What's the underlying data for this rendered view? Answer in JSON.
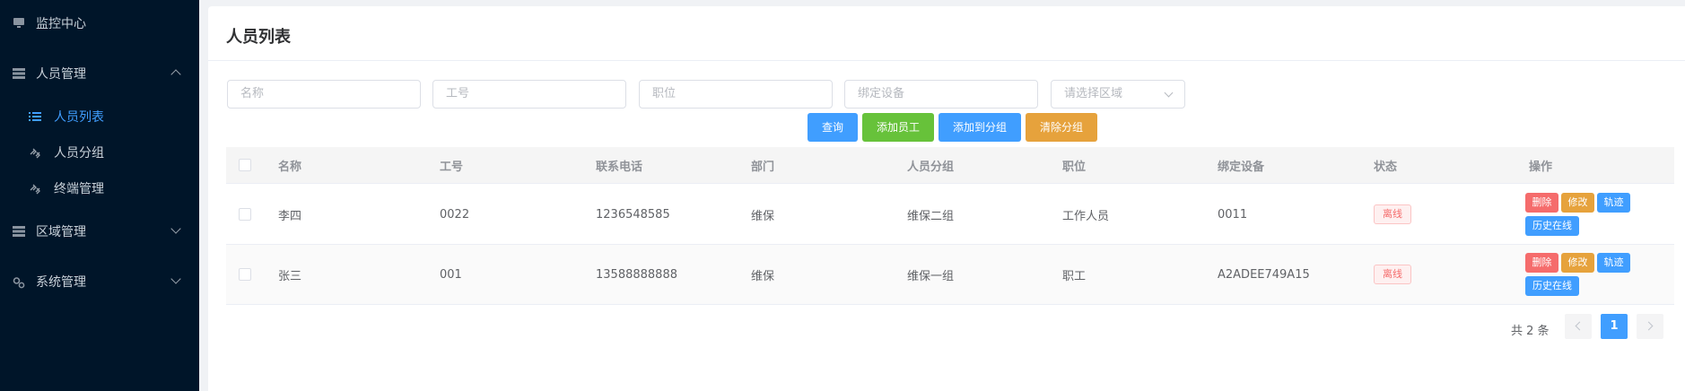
{
  "sidebar": {
    "items": [
      {
        "label": "监控中心",
        "icon": "monitor-icon"
      },
      {
        "label": "人员管理",
        "icon": "server-icon",
        "expanded": true,
        "children": [
          {
            "label": "人员列表",
            "icon": "list-icon",
            "active": true
          },
          {
            "label": "人员分组",
            "icon": "link-icon"
          },
          {
            "label": "终端管理",
            "icon": "link-icon"
          }
        ]
      },
      {
        "label": "区域管理",
        "icon": "server-icon",
        "expanded": false
      },
      {
        "label": "系统管理",
        "icon": "settings-icon",
        "expanded": false
      }
    ]
  },
  "page": {
    "title": "人员列表"
  },
  "filters": {
    "name_placeholder": "名称",
    "job_no_placeholder": "工号",
    "position_placeholder": "职位",
    "device_placeholder": "绑定设备",
    "area_placeholder": "请选择区域"
  },
  "actions": {
    "query": "查询",
    "add_employee": "添加员工",
    "add_to_group": "添加到分组",
    "clear_group": "清除分组"
  },
  "table": {
    "columns": [
      "名称",
      "工号",
      "联系电话",
      "部门",
      "人员分组",
      "职位",
      "绑定设备",
      "状态",
      "操作"
    ],
    "rows": [
      {
        "name": "李四",
        "job_no": "0022",
        "phone": "1236548585",
        "dept": "维保",
        "group": "维保二组",
        "position": "工作人员",
        "device": "0011",
        "status": "离线"
      },
      {
        "name": "张三",
        "job_no": "001",
        "phone": "13588888888",
        "dept": "维保",
        "group": "维保一组",
        "position": "职工",
        "device": "A2ADEE749A15",
        "status": "离线"
      }
    ],
    "row_ops": {
      "delete": "删除",
      "edit": "修改",
      "track": "轨迹",
      "history": "历史在线"
    }
  },
  "pagination": {
    "total_text": "共 2 条",
    "current_page": "1"
  },
  "colors": {
    "sidebar_bg": "#001529",
    "accent": "#409eff",
    "success": "#67c23a",
    "warning": "#e6a23c",
    "danger": "#f56c6c"
  }
}
